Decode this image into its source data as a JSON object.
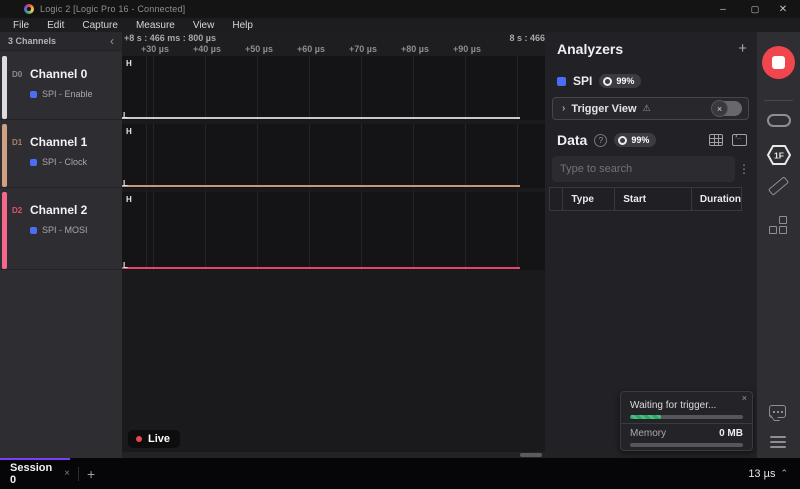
{
  "window": {
    "title": "Logic 2 [Logic Pro 16 - Connected]"
  },
  "icons": {
    "minimize": "–",
    "maximize": "▢",
    "close_window": "✕",
    "collapse_left": "‹",
    "chevron_right": "›",
    "warning": "⚠",
    "toggle_off_x": "×",
    "plus": "+",
    "help": "?",
    "kebab": "⋮",
    "close_small": "×",
    "chevron_up": "⌃"
  },
  "menu": {
    "items": [
      "File",
      "Edit",
      "Capture",
      "Measure",
      "View",
      "Help"
    ]
  },
  "channels": {
    "header": "3 Channels",
    "items": [
      {
        "id": "D0",
        "name": "Channel 0",
        "analyzer": "SPI - Enable",
        "stripe_color": "#dcdcde",
        "line_color": "#c9c9cb",
        "id_color": "#8d8d91"
      },
      {
        "id": "D1",
        "name": "Channel 1",
        "analyzer": "SPI - Clock",
        "stripe_color": "#cfa183",
        "line_color": "#c2997b",
        "id_color": "#b08066"
      },
      {
        "id": "D2",
        "name": "Channel 2",
        "analyzer": "SPI - MOSI",
        "stripe_color": "#f4688c",
        "line_color": "#e6456b",
        "id_color": "#e05273"
      }
    ]
  },
  "timeline": {
    "range_start": "+8 s : 466 ms : 800 µs",
    "range_end": "8 s : 466",
    "ticks": [
      "+30 µs",
      "+40 µs",
      "+50 µs",
      "+60 µs",
      "+70 µs",
      "+80 µs",
      "+90 µs"
    ]
  },
  "waveform": {
    "high_label": "H",
    "low_label": "L",
    "live_label": "Live"
  },
  "analyzers": {
    "title": "Analyzers",
    "spi_name": "SPI",
    "spi_progress": "99%",
    "trigger_view_label": "Trigger View"
  },
  "data_panel": {
    "title": "Data",
    "progress": "99%",
    "search_placeholder": "Type to search",
    "columns": [
      "Type",
      "Start",
      "Duration"
    ]
  },
  "status_popup": {
    "message": "Waiting for trigger...",
    "progress_percent": 27,
    "memory_label": "Memory",
    "memory_value": "0 MB"
  },
  "side_toolbar": {
    "trigger_label": "1F"
  },
  "bottom_bar": {
    "session_label": "Session 0",
    "time_display": "13 µs"
  },
  "colors": {
    "analyzer_blue": "#4a6df8",
    "record_red": "#f2464e",
    "session_purple": "#7a3ff2"
  }
}
